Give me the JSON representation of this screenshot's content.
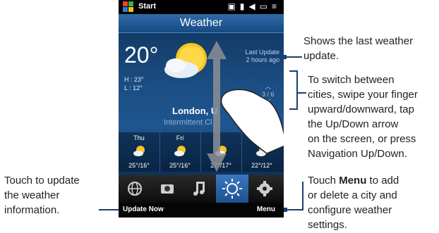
{
  "status_bar": {
    "start_label": "Start",
    "icons": [
      "network-icon",
      "signal-icon",
      "volume-icon",
      "battery-icon",
      "menu-lines-icon"
    ]
  },
  "title": "Weather",
  "current": {
    "temp": "20°",
    "high": "H : 23°",
    "low": "L : 12°"
  },
  "last_update": {
    "label": "Last Update",
    "value": "2 hours ago"
  },
  "city": {
    "name": "London, U",
    "condition": "Intermittent Cl",
    "page": "3 / 6"
  },
  "forecast": [
    {
      "day": "Thu",
      "range": "25°/16°"
    },
    {
      "day": "Fri",
      "range": "25°/16°"
    },
    {
      "day": "",
      "range": "27°/17°"
    },
    {
      "day": "",
      "range": "22°/12°"
    }
  ],
  "tabs": [
    "globe-icon",
    "camera-icon",
    "music-icon",
    "weather-sun-icon",
    "settings-gear-icon"
  ],
  "softkeys": {
    "left": "Update Now",
    "right": "Menu"
  },
  "callouts": {
    "last_update_1": "Shows the last weather",
    "last_update_2": "update.",
    "switch_1": "To switch between",
    "switch_2": "cities, swipe your finger",
    "switch_3": "upward/downward, tap",
    "switch_4": "the Up/Down arrow",
    "switch_5": "on the screen, or press",
    "switch_6": "Navigation Up/Down.",
    "update_1": "Touch to update",
    "update_2": "the weather",
    "update_3": "information.",
    "menu_1a": "Touch ",
    "menu_1b": "Menu",
    "menu_1c": " to add",
    "menu_2": "or delete a city and",
    "menu_3": "configure weather",
    "menu_4": "settings."
  },
  "colors": {
    "accent": "#1a3e6e",
    "tab_selected": "#2d6ab0"
  }
}
